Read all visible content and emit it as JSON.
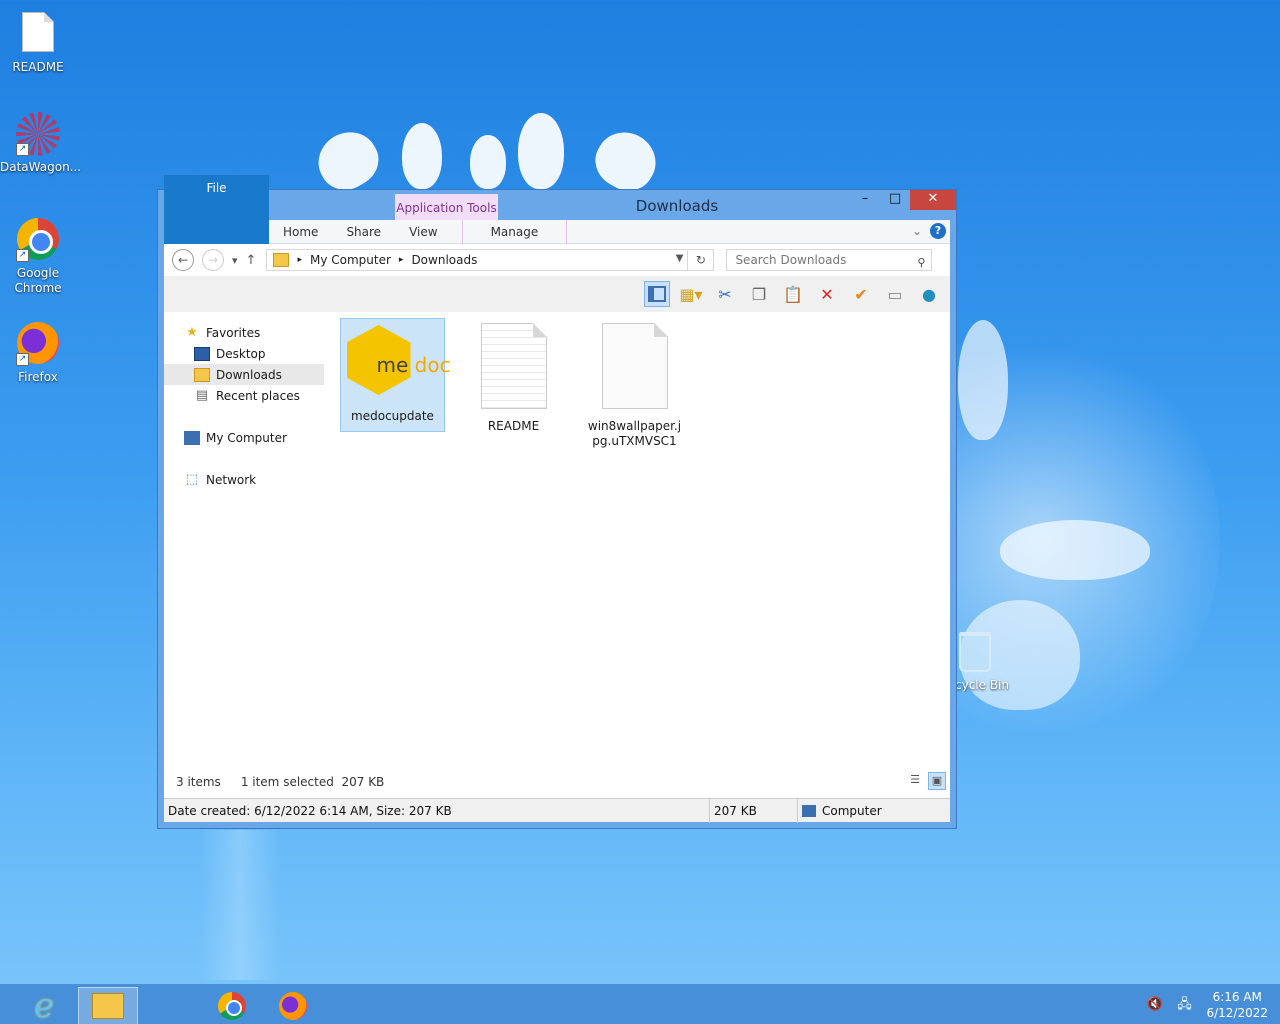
{
  "desktop": {
    "icons": [
      {
        "label": "README"
      },
      {
        "label": "DataWagon..."
      },
      {
        "label": "Google Chrome"
      },
      {
        "label": "Firefox"
      }
    ],
    "recycle_bin": "cycle Bin"
  },
  "window": {
    "title": "Downloads",
    "context_tab_group": "Application Tools",
    "ribbon_tabs": [
      "File",
      "Home",
      "Share",
      "View",
      "Manage"
    ],
    "help": "?",
    "address": {
      "segments": [
        "My Computer",
        "Downloads"
      ]
    },
    "search": {
      "placeholder": "Search Downloads"
    },
    "nav_pane": {
      "favorites": "Favorites",
      "desktop": "Desktop",
      "downloads": "Downloads",
      "recent_places": "Recent places",
      "my_computer": "My Computer",
      "network": "Network"
    },
    "files": [
      {
        "name": "medocupdate",
        "selected": true,
        "logo_me": "me",
        "logo_doc": "doc"
      },
      {
        "name": "README",
        "selected": false
      },
      {
        "name": "win8wallpaper.jpg.uTXMVSC1",
        "selected": false
      }
    ],
    "status": {
      "items": "3 items",
      "selected": "1 item selected  207 KB"
    },
    "details_bar": {
      "info": "Date created: 6/12/2022 6:14 AM, Size: 207 KB",
      "size": "207 KB",
      "location": "Computer"
    }
  },
  "taskbar": {
    "time": "6:16 AM",
    "date": "6/12/2022"
  },
  "colors": {
    "accent": "#1979ca",
    "close": "#c7463f",
    "selection": "#cce4f7",
    "app_tools": "#f3dcf7"
  }
}
